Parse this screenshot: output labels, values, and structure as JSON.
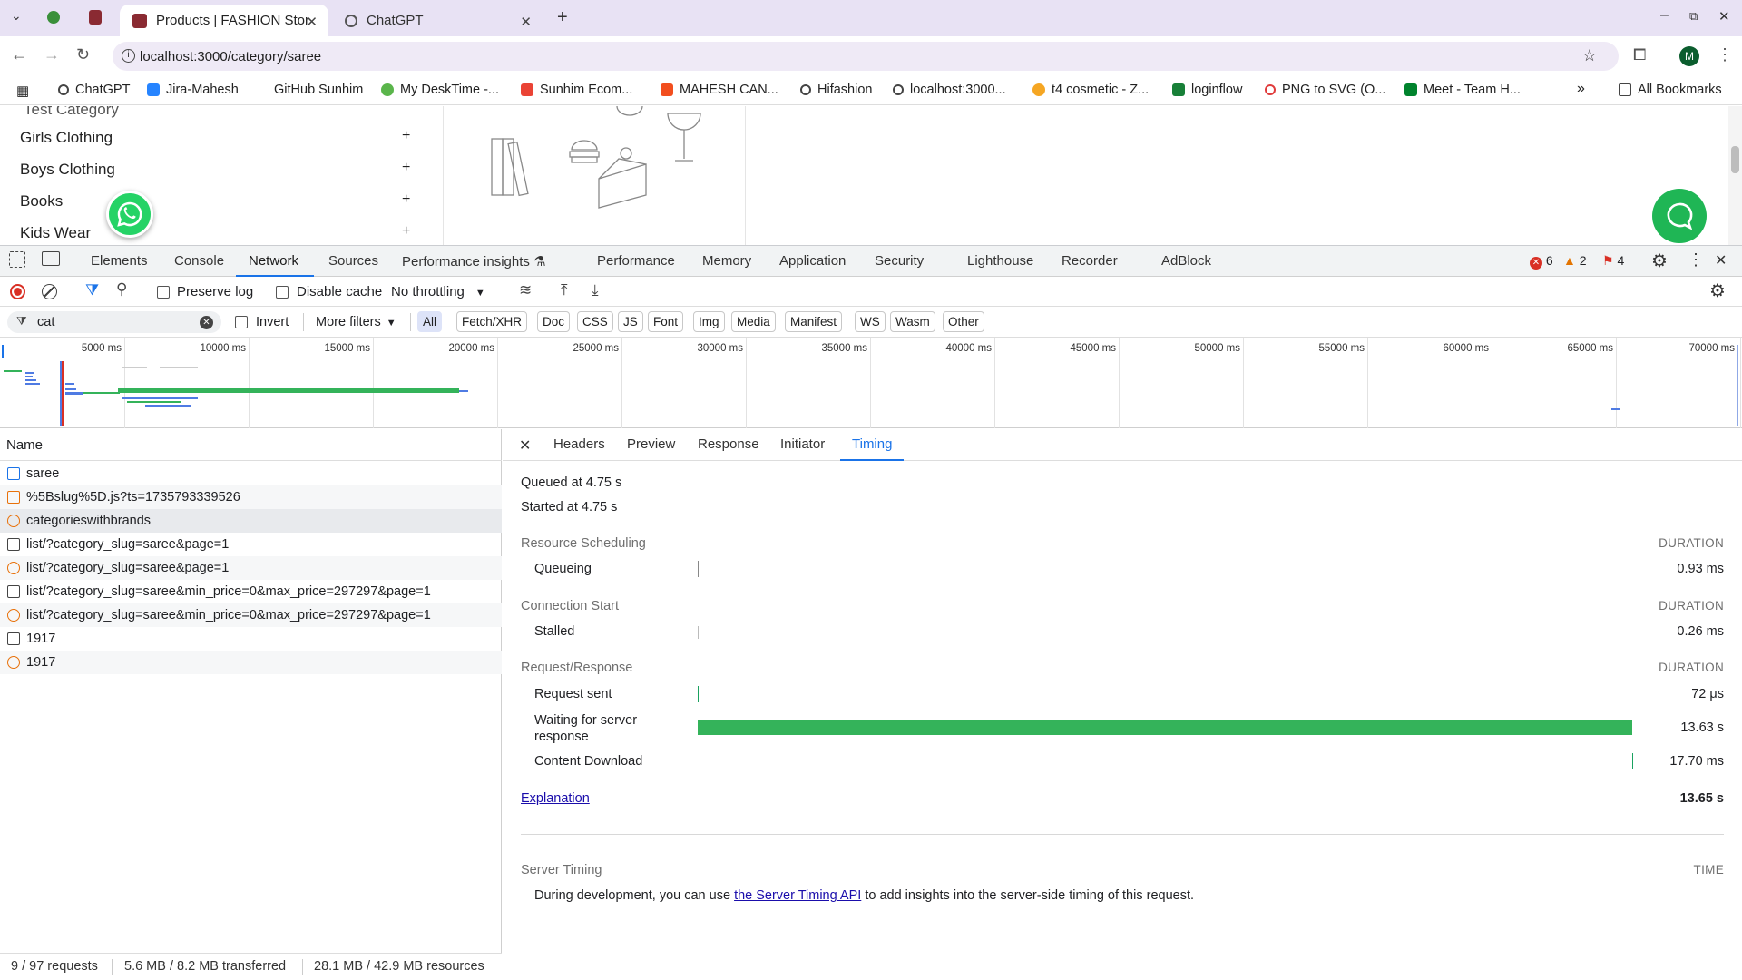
{
  "browser": {
    "tabs": [
      {
        "title": "Products | FASHION Stor",
        "active": true
      },
      {
        "title": "ChatGPT",
        "active": false
      }
    ],
    "url": "localhost:3000/category/saree",
    "profile_initial": "M",
    "window_controls": [
      "minimize",
      "restore",
      "close"
    ]
  },
  "bookmarks": {
    "items": [
      "ChatGPT",
      "Jira-Mahesh",
      "GitHub Sunhim",
      "My DeskTime -...",
      "Sunhim Ecom...",
      "MAHESH CAN...",
      "Hifashion",
      "localhost:3000...",
      "t4 cosmetic - Z...",
      "loginflow",
      "PNG to SVG (O...",
      "Meet - Team H..."
    ],
    "more": "»",
    "all_bookmarks": "All Bookmarks"
  },
  "page": {
    "partial_item": "Test Category",
    "categories": [
      "Girls Clothing",
      "Boys Clothing",
      "Books",
      "Kids Wear"
    ],
    "plus": "+"
  },
  "devtools": {
    "tabs": [
      "Elements",
      "Console",
      "Network",
      "Sources",
      "Performance insights",
      "Performance",
      "Memory",
      "Application",
      "Security",
      "Lighthouse",
      "Recorder",
      "AdBlock"
    ],
    "active_tab": "Network",
    "errors": "6",
    "warnings": "2",
    "issues": "4",
    "network_toolbar": {
      "preserve_log": "Preserve log",
      "disable_cache": "Disable cache",
      "throttling": "No throttling"
    },
    "filter": {
      "value": "cat",
      "invert": "Invert",
      "more_filters": "More filters",
      "types": [
        "All",
        "Fetch/XHR",
        "Doc",
        "CSS",
        "JS",
        "Font",
        "Img",
        "Media",
        "Manifest",
        "WS",
        "Wasm",
        "Other"
      ]
    },
    "overview_ticks": [
      "5000 ms",
      "10000 ms",
      "15000 ms",
      "20000 ms",
      "25000 ms",
      "30000 ms",
      "35000 ms",
      "40000 ms",
      "45000 ms",
      "50000 ms",
      "55000 ms",
      "60000 ms",
      "65000 ms",
      "70000 ms"
    ],
    "request_list": {
      "header": "Name",
      "rows": [
        {
          "name": "saree",
          "type": "doc"
        },
        {
          "name": "%5Bslug%5D.js?ts=1735793339526",
          "type": "script"
        },
        {
          "name": "categorieswithbrands",
          "type": "fetch"
        },
        {
          "name": "list/?category_slug=saree&page=1",
          "type": "preflight"
        },
        {
          "name": "list/?category_slug=saree&page=1",
          "type": "fetch"
        },
        {
          "name": "list/?category_slug=saree&min_price=0&max_price=297297&page=1",
          "type": "preflight"
        },
        {
          "name": "list/?category_slug=saree&min_price=0&max_price=297297&page=1",
          "type": "fetch"
        },
        {
          "name": "1917",
          "type": "preflight"
        },
        {
          "name": "1917",
          "type": "fetch"
        }
      ]
    },
    "detail_tabs": [
      "Headers",
      "Preview",
      "Response",
      "Initiator",
      "Timing"
    ],
    "active_detail_tab": "Timing",
    "timing": {
      "queued": "Queued at 4.75 s",
      "started": "Started at 4.75 s",
      "duration_label": "DURATION",
      "sections": [
        {
          "title": "Resource Scheduling",
          "rows": [
            {
              "label": "Queueing",
              "value": "0.93 ms"
            }
          ]
        },
        {
          "title": "Connection Start",
          "rows": [
            {
              "label": "Stalled",
              "value": "0.26 ms"
            }
          ]
        },
        {
          "title": "Request/Response",
          "rows": [
            {
              "label": "Request sent",
              "value": "72 μs"
            },
            {
              "label": "Waiting for server response",
              "value": "13.63 s"
            },
            {
              "label": "Content Download",
              "value": "17.70 ms"
            }
          ]
        }
      ],
      "explanation": "Explanation",
      "total": "13.65 s",
      "server_timing_title": "Server Timing",
      "time_label": "TIME",
      "server_timing_prefix": "During development, you can use",
      "server_timing_link": "the Server Timing API",
      "server_timing_suffix": "to add insights into the server-side timing of this request."
    },
    "status_bar": {
      "requests": "9 / 97 requests",
      "transferred": "5.6 MB / 8.2 MB transferred",
      "resources": "28.1 MB / 42.9 MB resources"
    }
  },
  "colors": {
    "tabstrip": "#e8e2f4",
    "accent": "#1a73e8",
    "waiting_bar": "#34b35a",
    "error": "#d93025",
    "warning": "#e37400"
  }
}
